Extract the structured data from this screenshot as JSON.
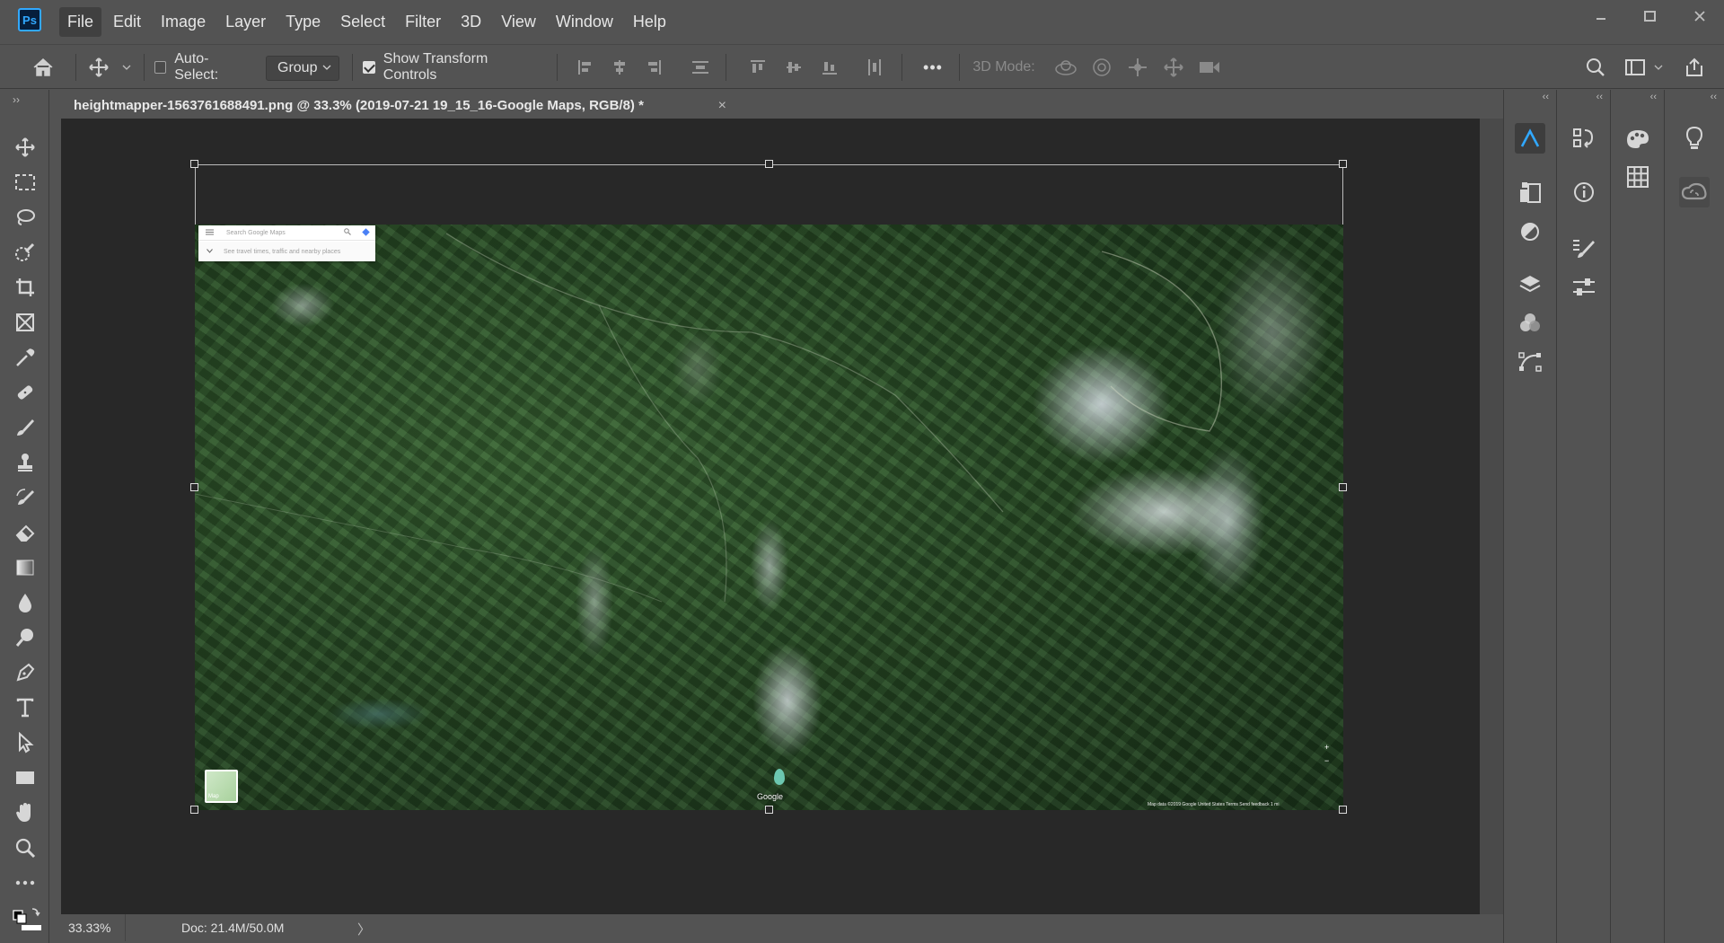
{
  "app": {
    "logo": "Ps",
    "menu": [
      "File",
      "Edit",
      "Image",
      "Layer",
      "Type",
      "Select",
      "Filter",
      "3D",
      "View",
      "Window",
      "Help"
    ],
    "window_controls": [
      "minimize-icon",
      "restore-icon",
      "close-icon"
    ]
  },
  "options_bar": {
    "auto_select_label": "Auto-Select:",
    "auto_select_checked": false,
    "group_select_value": "Group",
    "show_transform_label": "Show Transform Controls",
    "show_transform_checked": true,
    "mode_3d_label": "3D Mode:",
    "more_label": "•••"
  },
  "tools": [
    "move-tool-icon",
    "rectangular-marquee-icon",
    "lasso-icon",
    "quick-selection-icon",
    "crop-icon",
    "frame-icon",
    "eyedropper-icon",
    "healing-brush-icon",
    "brush-icon",
    "clone-stamp-icon",
    "history-brush-icon",
    "eraser-icon",
    "gradient-icon",
    "blur-icon",
    "dodge-icon",
    "pen-icon",
    "type-icon",
    "path-selection-icon",
    "rectangle-icon",
    "hand-icon",
    "zoom-icon",
    "more-tools-icon"
  ],
  "document": {
    "tab_title": "heightmapper-1563761688491.png @ 33.3% (2019-07-21 19_15_16-Google Maps, RGB/8) *",
    "close_label": "×"
  },
  "map": {
    "search_placeholder": "Search Google Maps",
    "directions_hint": "See travel times, traffic and nearby places",
    "layers_label": "Map",
    "google_label": "Google",
    "footer_text": "Map data ©2019 Google   United States   Terms   Send feedback   1 mi"
  },
  "status_bar": {
    "zoom": "33.33%",
    "doc_size": "Doc: 21.4M/50.0M",
    "arrow": "〉"
  },
  "panels": {
    "dock1": [
      "adobe-stock-icon",
      "libraries-icon",
      "adjustments-icon",
      "layers-icon",
      "channels-icon",
      "paths-icon"
    ],
    "dock2": [
      "history-icon",
      "info-icon",
      "brush-settings-icon",
      "properties-icon"
    ],
    "dock3": [
      "color-icon",
      "swatches-icon"
    ],
    "dock4": [
      "learn-icon",
      "creative-cloud-icon"
    ]
  },
  "colors": {
    "accent": "#31a8ff",
    "background": "#535353",
    "canvas": "#282828"
  }
}
